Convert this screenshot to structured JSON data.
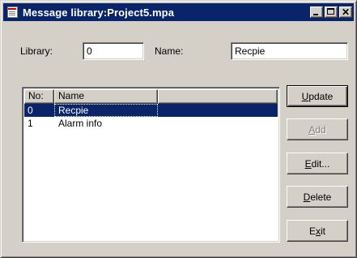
{
  "window": {
    "title": "Message library:Project5.mpa"
  },
  "form": {
    "library_label": "Library:",
    "library_value": "0",
    "name_label": "Name:",
    "name_value": "Recpie"
  },
  "list": {
    "columns": [
      "No:",
      "Name",
      ""
    ],
    "rows": [
      {
        "no": "0",
        "name": "Recpie",
        "selected": true
      },
      {
        "no": "1",
        "name": "Alarm info",
        "selected": false
      }
    ]
  },
  "buttons": {
    "update": {
      "label": "Update",
      "mnemonic": "U",
      "rest": "pdate"
    },
    "add": {
      "label": "Add",
      "mnemonic": "A",
      "rest": "dd",
      "disabled": true
    },
    "edit": {
      "label": "Edit...",
      "mnemonic": "E",
      "rest": "dit..."
    },
    "delete": {
      "label": "Delete",
      "mnemonic": "D",
      "rest": "elete"
    },
    "exit": {
      "label": "Exit",
      "pre": "E",
      "mnemonic": "x",
      "rest": "it"
    }
  },
  "colors": {
    "titlebar": "#0a246a",
    "face": "#d4d0c8",
    "selection": "#0a246a"
  },
  "icons": {
    "window": "document-icon",
    "minimize": "minimize-icon",
    "maximize": "maximize-icon",
    "close": "close-icon"
  }
}
